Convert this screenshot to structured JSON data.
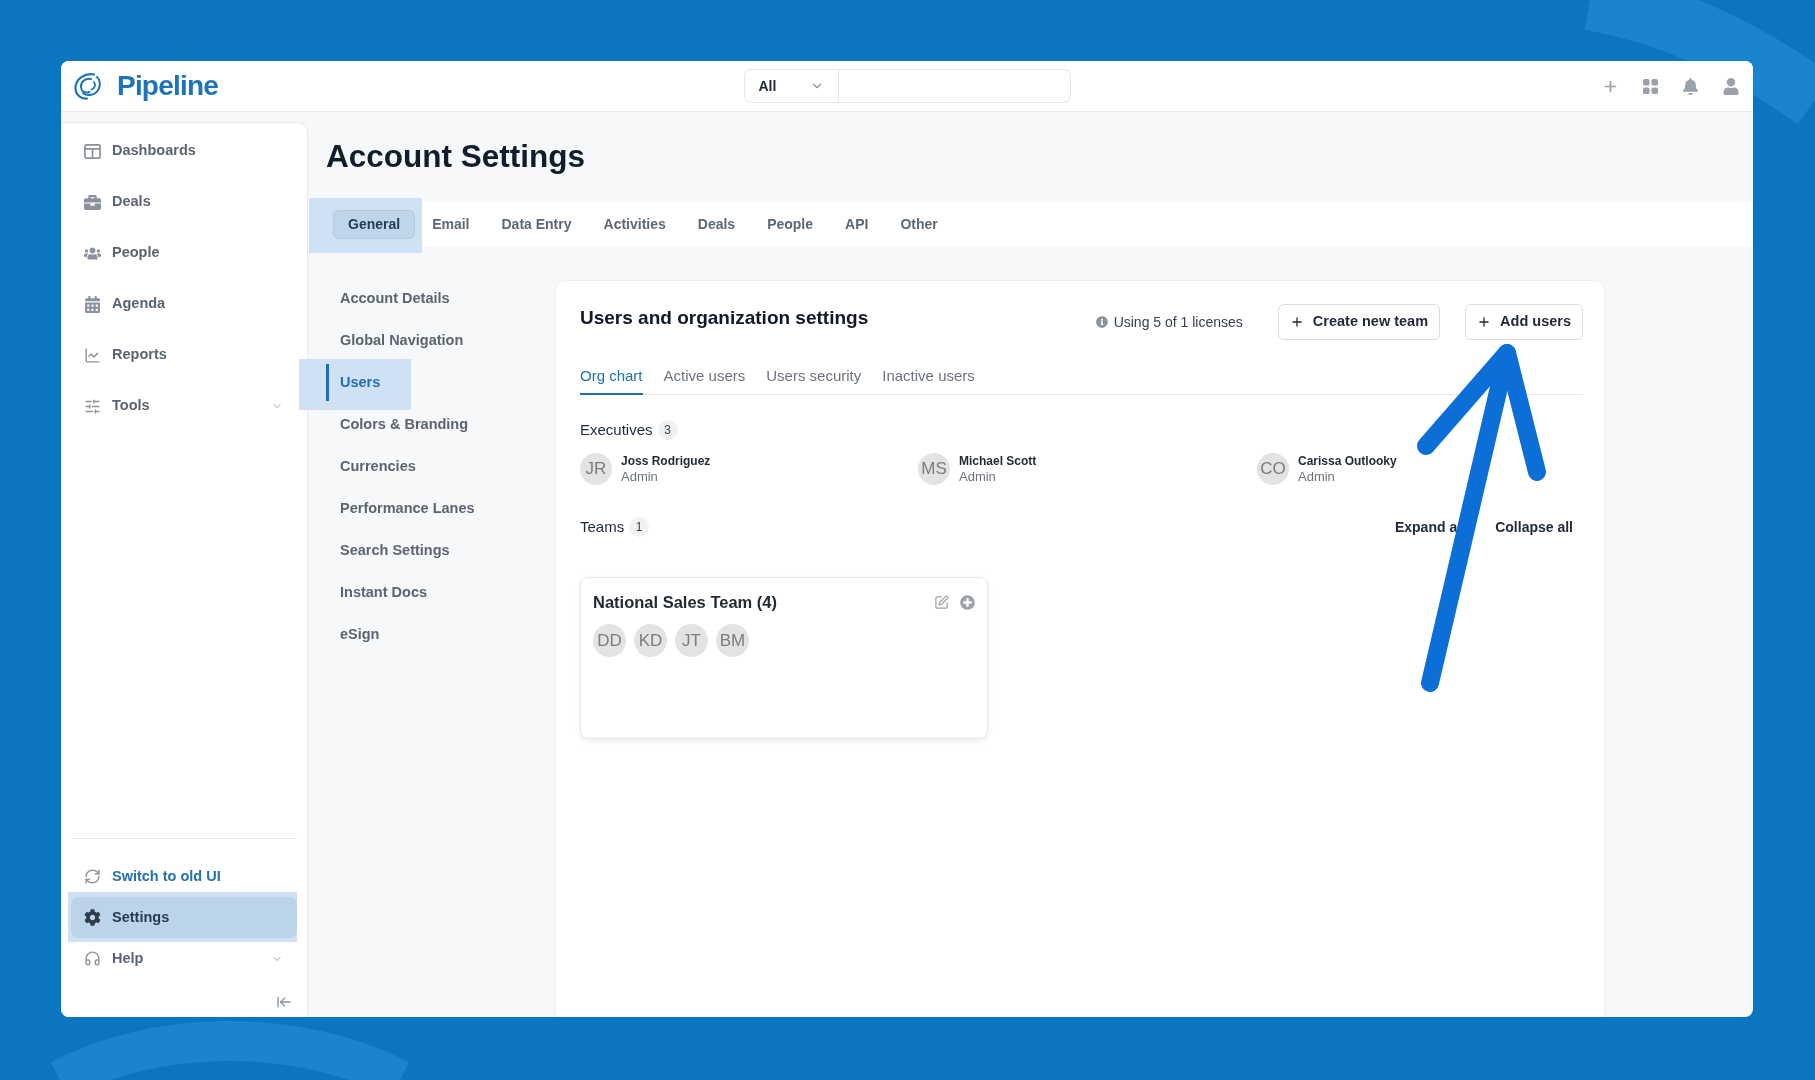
{
  "header": {
    "logo": "Pipeline",
    "search": {
      "scope": "All"
    }
  },
  "sidebar": {
    "items": [
      {
        "label": "Dashboards",
        "selected": false
      },
      {
        "label": "Deals",
        "selected": false
      },
      {
        "label": "People",
        "selected": false
      },
      {
        "label": "Agenda",
        "selected": false
      },
      {
        "label": "Reports",
        "selected": false
      },
      {
        "label": "Tools",
        "selected": false,
        "expanded": false
      }
    ],
    "footer_items": [
      {
        "kind": "link",
        "label": "Switch to old UI",
        "selected": false
      },
      {
        "kind": "item",
        "label": "Settings",
        "selected": true
      },
      {
        "kind": "item",
        "label": "Help",
        "selected": false,
        "expanded": false
      }
    ]
  },
  "page": {
    "title": "Account Settings",
    "tabs": [
      {
        "label": "General",
        "selected": true
      },
      {
        "label": "Email",
        "selected": false
      },
      {
        "label": "Data Entry",
        "selected": false
      },
      {
        "label": "Activities",
        "selected": false
      },
      {
        "label": "Deals",
        "selected": false
      },
      {
        "label": "People",
        "selected": false
      },
      {
        "label": "API",
        "selected": false
      },
      {
        "label": "Other",
        "selected": false
      }
    ],
    "subnav": [
      {
        "label": "Account Details",
        "selected": false
      },
      {
        "label": "Global Navigation",
        "selected": false
      },
      {
        "label": "Users",
        "selected": true
      },
      {
        "label": "Colors & Branding",
        "selected": false
      },
      {
        "label": "Currencies",
        "selected": false
      },
      {
        "label": "Performance Lanes",
        "selected": false
      },
      {
        "label": "Search Settings",
        "selected": false
      },
      {
        "label": "Instant Docs",
        "selected": false
      },
      {
        "label": "eSign",
        "selected": false
      }
    ]
  },
  "users_panel": {
    "title": "Users and organization settings",
    "license_info": "Using 5 of 1 licenses",
    "buttons": [
      "Create new team",
      "Add users"
    ],
    "tabs": [
      {
        "label": "Org chart",
        "selected": true
      },
      {
        "label": "Active users",
        "selected": false
      },
      {
        "label": "Users security",
        "selected": false
      },
      {
        "label": "Inactive users",
        "selected": false
      }
    ],
    "executives": {
      "label": "Executives",
      "count": "3",
      "people": [
        {
          "initials": "JR",
          "name": "Joss Rodriguez",
          "role": "Admin"
        },
        {
          "initials": "MS",
          "name": "Michael Scott",
          "role": "Admin"
        },
        {
          "initials": "CO",
          "name": "Carissa Outlooky",
          "role": "Admin"
        }
      ]
    },
    "teams": {
      "label": "Teams",
      "count": "1",
      "actions": [
        "Expand a",
        "Collapse all"
      ],
      "cards": [
        {
          "name": "National Sales Team (4)",
          "members": [
            "DD",
            "KD",
            "JT",
            "BM"
          ]
        }
      ]
    }
  },
  "annotations": [
    {
      "kind": "arrow"
    }
  ]
}
